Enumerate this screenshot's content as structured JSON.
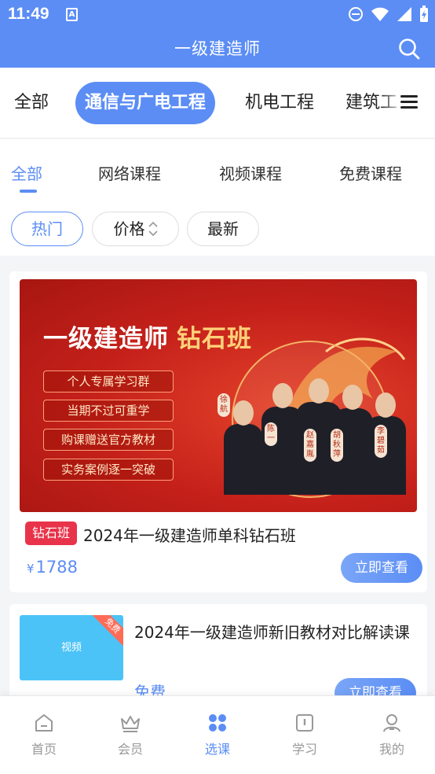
{
  "status": {
    "time": "11:49",
    "notif_icon": "A"
  },
  "header": {
    "title": "一级建造师"
  },
  "categories": [
    {
      "label": "全部"
    },
    {
      "label": "通信与广电工程",
      "active": true
    },
    {
      "label": "机电工程"
    },
    {
      "label": "建筑工"
    }
  ],
  "subtabs": [
    {
      "label": "全部",
      "active": true
    },
    {
      "label": "网络课程"
    },
    {
      "label": "视频课程"
    },
    {
      "label": "免费课程"
    }
  ],
  "filters": {
    "hot": "热门",
    "price": "价格",
    "latest": "最新"
  },
  "course1": {
    "banner_title": "一级建造师",
    "banner_highlight": "钻石班",
    "benefits": [
      "个人专属学习群",
      "当期不过可重学",
      "购课赠送官方教材",
      "实务案例逐一突破"
    ],
    "teachers": [
      "徐航",
      "陈一",
      "赵嘉胤",
      "胡秋萍",
      "李碧茹"
    ],
    "tag": "钻石班",
    "name": "2024年一级建造师单科钻石班",
    "currency": "¥",
    "price": "1788",
    "button": "立即查看"
  },
  "course2": {
    "thumb_label": "视频",
    "ribbon": "免费",
    "name": "2024年一级建造师新旧教材对比解读课",
    "price": "免费",
    "button": "立即查看"
  },
  "nav": [
    {
      "label": "首页",
      "icon": "home-icon"
    },
    {
      "label": "会员",
      "icon": "crown-icon"
    },
    {
      "label": "选课",
      "icon": "grid-icon",
      "active": true
    },
    {
      "label": "学习",
      "icon": "book-icon"
    },
    {
      "label": "我的",
      "icon": "user-icon"
    }
  ],
  "colors": {
    "primary": "#5b8df5",
    "tag_red": "#e8334a",
    "banner_red": "#c4201a"
  }
}
